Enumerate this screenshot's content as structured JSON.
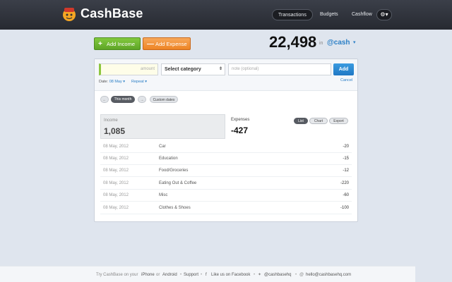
{
  "app": {
    "name": "CashBase",
    "nav": [
      {
        "label": "Transactions",
        "active": true
      },
      {
        "label": "Budgets",
        "active": false
      },
      {
        "label": "Cashflow",
        "active": false
      }
    ],
    "settings_icon": "gear-icon"
  },
  "actions": {
    "add_income": "Add Income",
    "add_expense": "Add Expense",
    "income_icon": "+",
    "expense_icon": "—"
  },
  "balance": {
    "value": "22,498",
    "in_label": "in",
    "account": "@cash"
  },
  "form": {
    "amount_placeholder": "amount",
    "category": "Select category",
    "note_placeholder": "note (optional)",
    "add_label": "Add",
    "date_label": "Date:",
    "date_value": "08 May",
    "repeat_label": "Repeat",
    "cancel_label": "Cancel"
  },
  "period": {
    "prev": "←",
    "current": "This month",
    "next": "→",
    "custom": "Custom dates"
  },
  "summary": {
    "income_label": "Income",
    "income_value": "1,085",
    "expenses_label": "Expenses",
    "expenses_value": "-427",
    "views": [
      "List",
      "Chart",
      "Export"
    ],
    "active_view": "List"
  },
  "transactions": [
    {
      "date": "08 May, 2012",
      "category": "Car",
      "amount": "-20"
    },
    {
      "date": "08 May, 2012",
      "category": "Education",
      "amount": "-15"
    },
    {
      "date": "08 May, 2012",
      "category": "Food/Groceries",
      "amount": "-12"
    },
    {
      "date": "08 May, 2012",
      "category": "Eating Out & Coffee",
      "amount": "-220"
    },
    {
      "date": "08 May, 2012",
      "category": "Misc",
      "amount": "-60"
    },
    {
      "date": "08 May, 2012",
      "category": "Clothes & Shoes",
      "amount": "-100"
    }
  ],
  "footer": {
    "try": "Try CashBase on your",
    "iphone": "iPhone",
    "or": "or",
    "android": "Android",
    "support": "Support",
    "facebook": "Like us on Facebook",
    "twitter": "@cashbasehq",
    "email": "hello@cashbasehq.com",
    "separator": "•"
  },
  "colors": {
    "topbar": "#2f323a",
    "accent_blue": "#2b7fc6",
    "income_green": "#6bb42f",
    "expense_orange": "#f09233",
    "background": "#dfe5ee"
  }
}
